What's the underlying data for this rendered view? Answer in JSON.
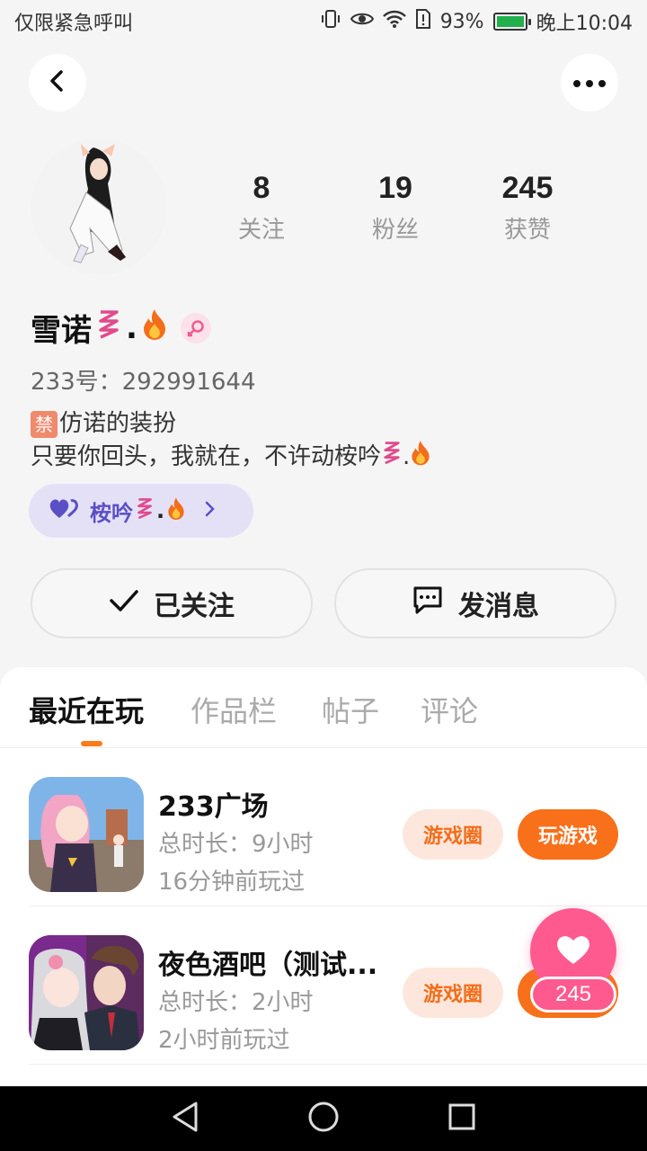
{
  "status_bar": {
    "left_text": "仅限紧急呼叫",
    "battery": "93%",
    "time": "晚上10:04"
  },
  "profile": {
    "stats": [
      {
        "num": "8",
        "label": "关注"
      },
      {
        "num": "19",
        "label": "粉丝"
      },
      {
        "num": "245",
        "label": "获赞"
      }
    ],
    "name": "雪诺",
    "name_suffix": ".",
    "id_label": "233号：",
    "id_value": "292991644",
    "bio_ban_char": "禁",
    "bio_line1": "仿诺的装扮",
    "bio_line2": "只要你回头，我就在，不许动桉吟",
    "bio_line2_suffix": ".",
    "group_chip_label": "桉吟",
    "group_chip_suffix": "."
  },
  "actions": {
    "follow_label": "已关注",
    "message_label": "发消息"
  },
  "tabs": [
    "最近在玩",
    "作品栏",
    "帖子",
    "评论"
  ],
  "games": [
    {
      "name": "233广场",
      "duration": "总时长：9小时",
      "last_played": "16分钟前玩过",
      "circle_label": "游戏圈",
      "play_label": "玩游戏"
    },
    {
      "name": "夜色酒吧（测试...",
      "duration": "总时长：2小时",
      "last_played": "2小时前玩过",
      "circle_label": "游戏圈"
    }
  ],
  "like_fab": {
    "count": "245"
  },
  "colors": {
    "accent_orange": "#f8701a",
    "like_pink": "#ff5a8f",
    "chip_purple": "#5b4fc6"
  }
}
